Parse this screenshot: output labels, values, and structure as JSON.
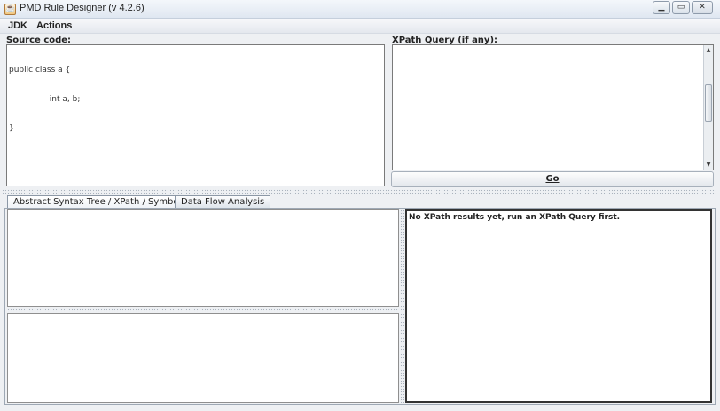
{
  "window": {
    "title": "PMD Rule Designer (v 4.2.6)"
  },
  "menu": [
    "JDK",
    "Actions"
  ],
  "source": {
    "label": "Source code:",
    "lines": [
      "public class a {",
      "                int a, b;",
      "}"
    ]
  },
  "query": {
    "label": "XPath Query (if any):",
    "value": ""
  },
  "go_button": {
    "label": "Go"
  },
  "tabs": [
    "Abstract Syntax Tree / XPath / Symbol Table",
    "Data Flow Analysis"
  ],
  "results": {
    "message": "No XPath results yet, run an XPath Query first."
  },
  "icons": {
    "app": "java-cup-icon",
    "minimize": "minimize-icon",
    "maximize": "maximize-icon",
    "close": "close-icon",
    "scroll_up": "arrow-up-icon",
    "scroll_down": "arrow-down-icon"
  }
}
